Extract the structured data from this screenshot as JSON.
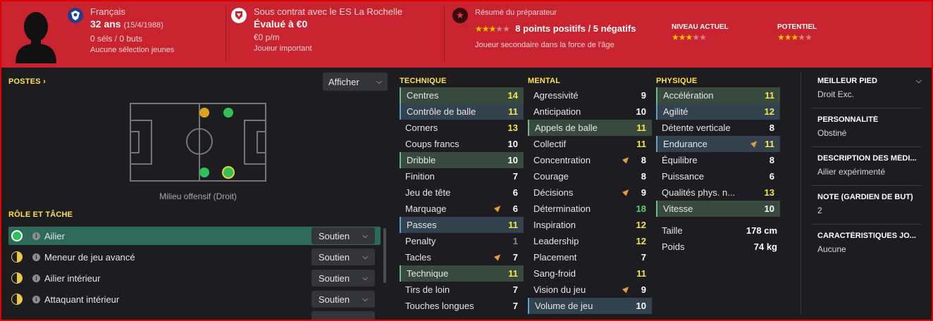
{
  "colors": {
    "accent": "#ffe24d",
    "header": "#c9232f",
    "val_white": "#ffffff",
    "val_yellow": "#f5e64a",
    "val_green": "#58d26a",
    "val_grey": "#8c8c94",
    "dot_green": "#2fc15a",
    "dot_orange": "#e0a020",
    "role_half": "#e8c84a"
  },
  "header": {
    "nationality": "Français",
    "age": "32 ans",
    "dob": "(15/4/1988)",
    "caps": "0 séls / 0 buts",
    "youth": "Aucune sélection jeunes",
    "contract": "Sous contrat avec le ES La Rochelle",
    "value": "Évalué à €0",
    "wage": "€0 p/m",
    "status": "Joueur important",
    "scout_title": "Résumé du préparateur",
    "scout_points": "8 points positifs / 5 négatifs",
    "scout_note": "Joueur secondaire dans la force de l'âge",
    "current_label": "NIVEAU ACTUEL",
    "potential_label": "POTENTIEL",
    "scout_stars": 3,
    "current_stars": 3,
    "potential_stars": 3,
    "star_max": 5
  },
  "positions": {
    "title": "POSTES",
    "title_chevron": "›",
    "show_button": "Afficher",
    "caption": "Milieu offensif (Droit)"
  },
  "roles": {
    "title": "RÔLE ET TÂCHE",
    "items": [
      {
        "name": "Ailier",
        "duty": "Soutien"
      },
      {
        "name": "Meneur de jeu avancé",
        "duty": "Soutien"
      },
      {
        "name": "Ailier intérieur",
        "duty": "Soutien"
      },
      {
        "name": "Attaquant intérieur",
        "duty": "Soutien"
      }
    ]
  },
  "attributes": {
    "technique_title": "TECHNIQUE",
    "mental_title": "MENTAL",
    "physique_title": "PHYSIQUE",
    "technique": [
      {
        "name": "Centres",
        "value": "14"
      },
      {
        "name": "Contrôle de balle",
        "value": "11"
      },
      {
        "name": "Corners",
        "value": "13"
      },
      {
        "name": "Coups francs",
        "value": "10"
      },
      {
        "name": "Dribble",
        "value": "10"
      },
      {
        "name": "Finition",
        "value": "7"
      },
      {
        "name": "Jeu de tête",
        "value": "6"
      },
      {
        "name": "Marquage",
        "value": "6"
      },
      {
        "name": "Passes",
        "value": "11"
      },
      {
        "name": "Penalty",
        "value": "1"
      },
      {
        "name": "Tacles",
        "value": "7"
      },
      {
        "name": "Technique",
        "value": "11"
      },
      {
        "name": "Tirs de loin",
        "value": "7"
      },
      {
        "name": "Touches longues",
        "value": "7"
      }
    ],
    "mental": [
      {
        "name": "Agressivité",
        "value": "9"
      },
      {
        "name": "Anticipation",
        "value": "10"
      },
      {
        "name": "Appels de balle",
        "value": "11"
      },
      {
        "name": "Collectif",
        "value": "11"
      },
      {
        "name": "Concentration",
        "value": "8"
      },
      {
        "name": "Courage",
        "value": "8"
      },
      {
        "name": "Décisions",
        "value": "9"
      },
      {
        "name": "Détermination",
        "value": "18"
      },
      {
        "name": "Inspiration",
        "value": "12"
      },
      {
        "name": "Leadership",
        "value": "12"
      },
      {
        "name": "Placement",
        "value": "7"
      },
      {
        "name": "Sang-froid",
        "value": "11"
      },
      {
        "name": "Vision du jeu",
        "value": "9"
      },
      {
        "name": "Volume de jeu",
        "value": "10"
      }
    ],
    "physique": [
      {
        "name": "Accélération",
        "value": "11"
      },
      {
        "name": "Agilité",
        "value": "12"
      },
      {
        "name": "Détente verticale",
        "value": "8"
      },
      {
        "name": "Endurance",
        "value": "11"
      },
      {
        "name": "Équilibre",
        "value": "8"
      },
      {
        "name": "Puissance",
        "value": "6"
      },
      {
        "name": "Qualités phys. n...",
        "value": "13"
      },
      {
        "name": "Vitesse",
        "value": "10"
      }
    ],
    "height_label": "Taille",
    "height_value": "178 cm",
    "weight_label": "Poids",
    "weight_value": "74 kg"
  },
  "details": {
    "foot_title": "MEILLEUR PIED",
    "foot_value": "Droit Exc.",
    "personality_title": "PERSONNALITÉ",
    "personality_value": "Obstiné",
    "media_title": "DESCRIPTION DES MÉDI...",
    "media_value": "Ailier expérimenté",
    "gk_title": "NOTE (GARDIEN DE BUT)",
    "gk_value": "2",
    "traits_title": "CARACTÉRISTIQUES JO...",
    "traits_value": "Aucune"
  }
}
